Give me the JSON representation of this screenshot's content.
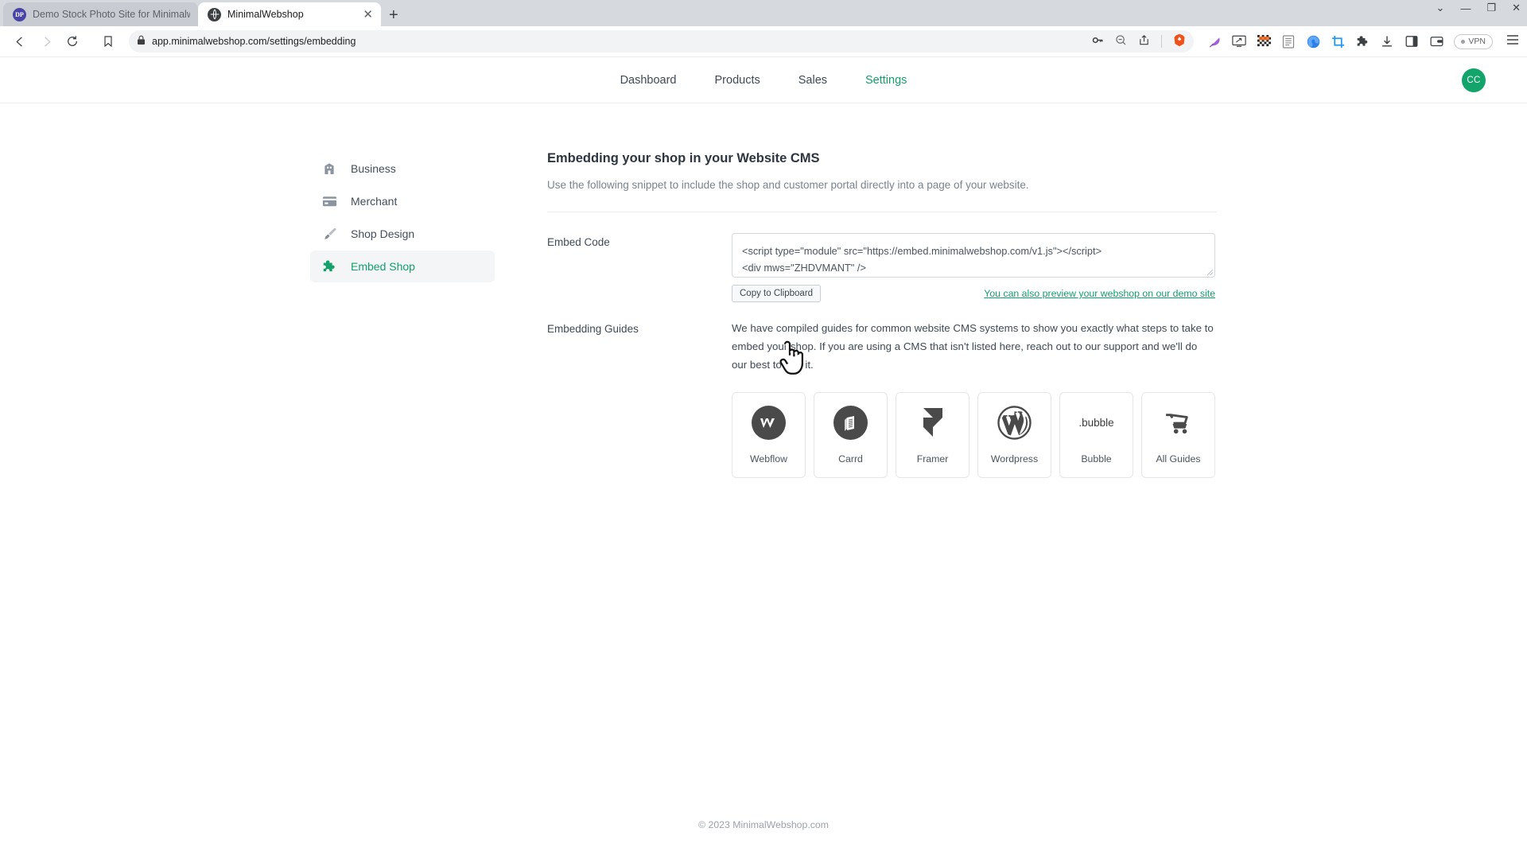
{
  "browser": {
    "tabs": [
      {
        "title": "Demo Stock Photo Site for Minimalwe",
        "favicon": "purple-globe-icon",
        "active": false
      },
      {
        "title": "MinimalWebshop",
        "favicon": "globe-icon",
        "active": true
      }
    ],
    "new_tab_label": "+",
    "window_controls": {
      "minimize": "—",
      "maximize": "❐",
      "close": "✕",
      "list_tabs": "⌄"
    },
    "nav": {
      "back": "◁",
      "forward": "▷",
      "reload": "↻",
      "bookmark": "bookmark-icon"
    },
    "url": "app.minimalwebshop.com/settings/embedding",
    "url_lock": "lock-icon",
    "url_right_icons": [
      "key-icon",
      "zoom-out-icon",
      "share-icon",
      "brave-lion-icon"
    ],
    "extensions": [
      "feather-icon",
      "screen-icon",
      "checker-icon",
      "reader-icon",
      "blue-swirl-icon",
      "crop-icon",
      "puzzle-icon",
      "download-icon",
      "sidebar-icon",
      "wallet-icon"
    ],
    "vpn_label": "VPN",
    "menu": "hamburger-menu-icon"
  },
  "app": {
    "nav_items": [
      {
        "label": "Dashboard",
        "active": false
      },
      {
        "label": "Products",
        "active": false
      },
      {
        "label": "Sales",
        "active": false
      },
      {
        "label": "Settings",
        "active": true
      }
    ],
    "avatar_initials": "CC",
    "accent_color": "#13a06a"
  },
  "settings_nav": [
    {
      "label": "Business",
      "icon": "building-icon",
      "active": false
    },
    {
      "label": "Merchant",
      "icon": "credit-card-icon",
      "active": false
    },
    {
      "label": "Shop Design",
      "icon": "paintbrush-icon",
      "active": false
    },
    {
      "label": "Embed Shop",
      "icon": "puzzle-piece-icon",
      "active": true
    }
  ],
  "main": {
    "heading": "Embedding your shop in your Website CMS",
    "subheading": "Use the following snippet to include the shop and customer portal directly into a page of your website.",
    "embed_code": {
      "label": "Embed Code",
      "line1": "<script type=\"module\" src=\"https://embed.minimalwebshop.com/v1.js\"></script>",
      "line2": "<div mws=\"ZHDVMANT\" />",
      "copy_button": "Copy to Clipboard",
      "preview_link": "You can also preview your webshop on our demo site"
    },
    "embedding_guides": {
      "label": "Embedding Guides",
      "paragraph": "We have compiled guides for common website CMS systems to show you exactly what steps to take to embed your shop. If you are using a CMS that isn't listed here, reach out to our support and we'll do our best to add it.",
      "cards": [
        {
          "label": "Webflow",
          "icon": "webflow-logo-icon"
        },
        {
          "label": "Carrd",
          "icon": "carrd-logo-icon"
        },
        {
          "label": "Framer",
          "icon": "framer-logo-icon"
        },
        {
          "label": "Wordpress",
          "icon": "wordpress-logo-icon"
        },
        {
          "label": "Bubble",
          "icon": "bubble-logo-icon"
        },
        {
          "label": "All Guides",
          "icon": "shop-cart-icon"
        }
      ]
    }
  },
  "footer": "© 2023 MinimalWebshop.com"
}
